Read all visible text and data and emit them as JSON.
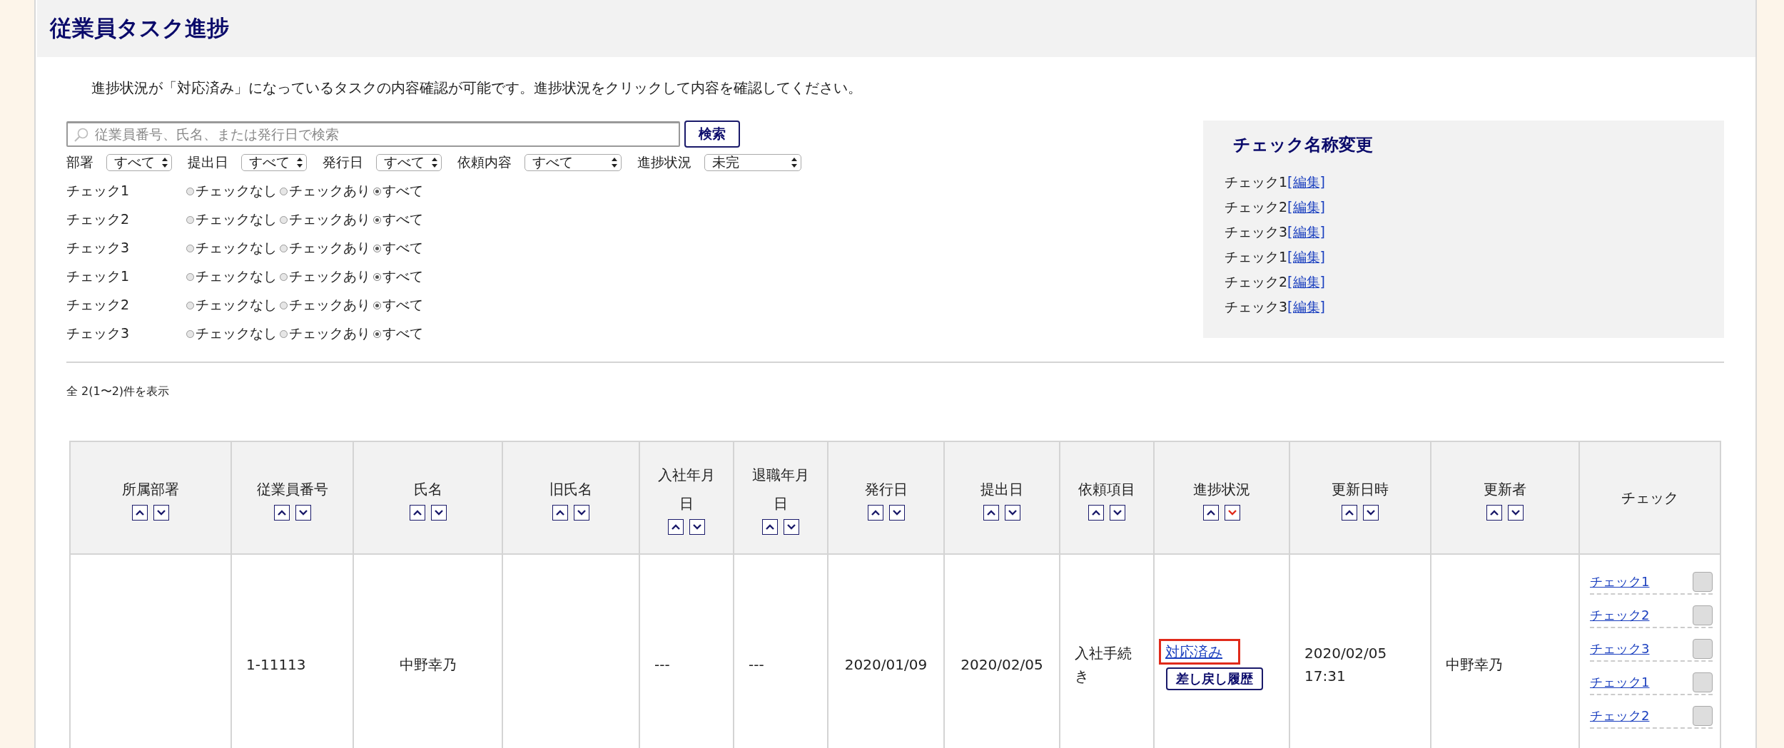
{
  "page_title": "従業員タスク進捗",
  "description": "進捗状況が「対応済み」になっているタスクの内容確認が可能です。進捗状況をクリックして内容を確認してください。",
  "search": {
    "placeholder": "従業員番号、氏名、または発行日で検索",
    "button": "検索"
  },
  "selects": [
    {
      "label": "部署",
      "value": "すべて",
      "wide": false
    },
    {
      "label": "提出日",
      "value": "すべて",
      "wide": false
    },
    {
      "label": "発行日",
      "value": "すべて",
      "wide": false
    },
    {
      "label": "依頼内容",
      "value": "すべて",
      "wide": true
    },
    {
      "label": "進捗状況",
      "value": "未完",
      "wide": true
    }
  ],
  "check_filters": [
    {
      "label": "チェック1",
      "options": [
        {
          "label": "チェックなし",
          "selected": false
        },
        {
          "label": "チェックあり",
          "selected": false
        },
        {
          "label": "すべて",
          "selected": true
        }
      ]
    },
    {
      "label": "チェック2",
      "options": [
        {
          "label": "チェックなし",
          "selected": false
        },
        {
          "label": "チェックあり",
          "selected": false
        },
        {
          "label": "すべて",
          "selected": true
        }
      ]
    },
    {
      "label": "チェック3",
      "options": [
        {
          "label": "チェックなし",
          "selected": false
        },
        {
          "label": "チェックあり",
          "selected": false
        },
        {
          "label": "すべて",
          "selected": true
        }
      ]
    },
    {
      "label": "チェック1",
      "options": [
        {
          "label": "チェックなし",
          "selected": false
        },
        {
          "label": "チェックあり",
          "selected": false
        },
        {
          "label": "すべて",
          "selected": true
        }
      ]
    },
    {
      "label": "チェック2",
      "options": [
        {
          "label": "チェックなし",
          "selected": false
        },
        {
          "label": "チェックあり",
          "selected": false
        },
        {
          "label": "すべて",
          "selected": true
        }
      ]
    },
    {
      "label": "チェック3",
      "options": [
        {
          "label": "チェックなし",
          "selected": false
        },
        {
          "label": "チェックあり",
          "selected": false
        },
        {
          "label": "すべて",
          "selected": true
        }
      ]
    }
  ],
  "rename_panel": {
    "title": "チェック名称変更",
    "items": [
      {
        "name": "チェック1",
        "link": "[編集]"
      },
      {
        "name": "チェック2",
        "link": "[編集]"
      },
      {
        "name": "チェック3",
        "link": "[編集]"
      },
      {
        "name": "チェック1",
        "link": "[編集]"
      },
      {
        "name": "チェック2",
        "link": "[編集]"
      },
      {
        "name": "チェック3",
        "link": "[編集]"
      }
    ]
  },
  "result_count": "全 2(1〜2)件を表示",
  "table": {
    "columns": [
      {
        "label": "所属部署",
        "sort": {
          "up_selected": false,
          "down_selected": false
        }
      },
      {
        "label": "従業員番号",
        "sort": {
          "up_selected": false,
          "down_selected": false
        }
      },
      {
        "label": "氏名",
        "sort": {
          "up_selected": false,
          "down_selected": false
        }
      },
      {
        "label": "旧氏名",
        "sort": {
          "up_selected": false,
          "down_selected": false
        }
      },
      {
        "label": "入社年月日",
        "sort": {
          "up_selected": false,
          "down_selected": false
        }
      },
      {
        "label": "退職年月日",
        "sort": {
          "up_selected": false,
          "down_selected": false
        }
      },
      {
        "label": "発行日",
        "sort": {
          "up_selected": false,
          "down_selected": false
        }
      },
      {
        "label": "提出日",
        "sort": {
          "up_selected": false,
          "down_selected": false
        }
      },
      {
        "label": "依頼項目",
        "sort": {
          "up_selected": false,
          "down_selected": false
        }
      },
      {
        "label": "進捗状況",
        "sort": {
          "up_selected": false,
          "down_selected": true
        }
      },
      {
        "label": "更新日時",
        "sort": {
          "up_selected": false,
          "down_selected": false
        }
      },
      {
        "label": "更新者",
        "sort": {
          "up_selected": false,
          "down_selected": false
        }
      },
      {
        "label": "チェック"
      }
    ],
    "rows": [
      {
        "department": "",
        "employee_no": "1-11113",
        "name": "中野幸乃",
        "former_name": "",
        "hire_date": "---",
        "retire_date": "---",
        "issue_date": "2020/01/09",
        "submit_date": "2020/02/05",
        "request_item": "入社手続き",
        "status": {
          "link": "対応済み",
          "highlighted": true,
          "button": "差し戻し履歴"
        },
        "updated_at": "2020/02/05 17:31",
        "updated_by": "中野幸乃",
        "checks": [
          {
            "label": "チェック1",
            "checked": false
          },
          {
            "label": "チェック2",
            "checked": false
          },
          {
            "label": "チェック3",
            "checked": false
          },
          {
            "label": "チェック1",
            "checked": false
          },
          {
            "label": "チェック2",
            "checked": false
          }
        ]
      }
    ]
  }
}
